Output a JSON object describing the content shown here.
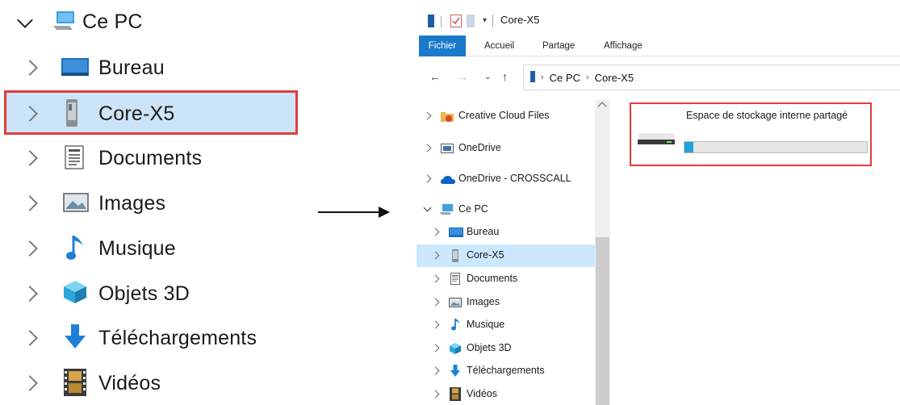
{
  "zoom_tree": {
    "root_label": "Ce PC",
    "items": [
      {
        "label": "Bureau",
        "icon": "desktop-icon"
      },
      {
        "label": "Core-X5",
        "icon": "phone-icon",
        "selected": true
      },
      {
        "label": "Documents",
        "icon": "documents-icon"
      },
      {
        "label": "Images",
        "icon": "images-icon"
      },
      {
        "label": "Musique",
        "icon": "music-icon"
      },
      {
        "label": "Objets 3D",
        "icon": "objects3d-icon"
      },
      {
        "label": "Téléchargements",
        "icon": "downloads-icon"
      },
      {
        "label": "Vidéos",
        "icon": "videos-icon"
      }
    ]
  },
  "window": {
    "title": "Core-X5",
    "ribbon_tabs": [
      "Fichier",
      "Accueil",
      "Partage",
      "Affichage"
    ],
    "breadcrumb": [
      "Ce PC",
      "Core-X5"
    ],
    "nav_items": [
      {
        "label": "Creative Cloud Files"
      },
      {
        "label": "OneDrive"
      },
      {
        "label": "OneDrive - CROSSCALL"
      },
      {
        "label": "Ce PC"
      },
      {
        "label": "Bureau"
      },
      {
        "label": "Core-X5",
        "selected": true
      },
      {
        "label": "Documents"
      },
      {
        "label": "Images"
      },
      {
        "label": "Musique"
      },
      {
        "label": "Objets 3D"
      },
      {
        "label": "Téléchargements"
      },
      {
        "label": "Vidéos"
      }
    ],
    "drive": {
      "name": "Espace de stockage interne partagé",
      "used_fraction": 0.05
    }
  },
  "colors": {
    "accent": "#1979ca",
    "selection": "#cce8ff",
    "highlight_box": "#e03c3c",
    "progress": "#26a0da"
  }
}
